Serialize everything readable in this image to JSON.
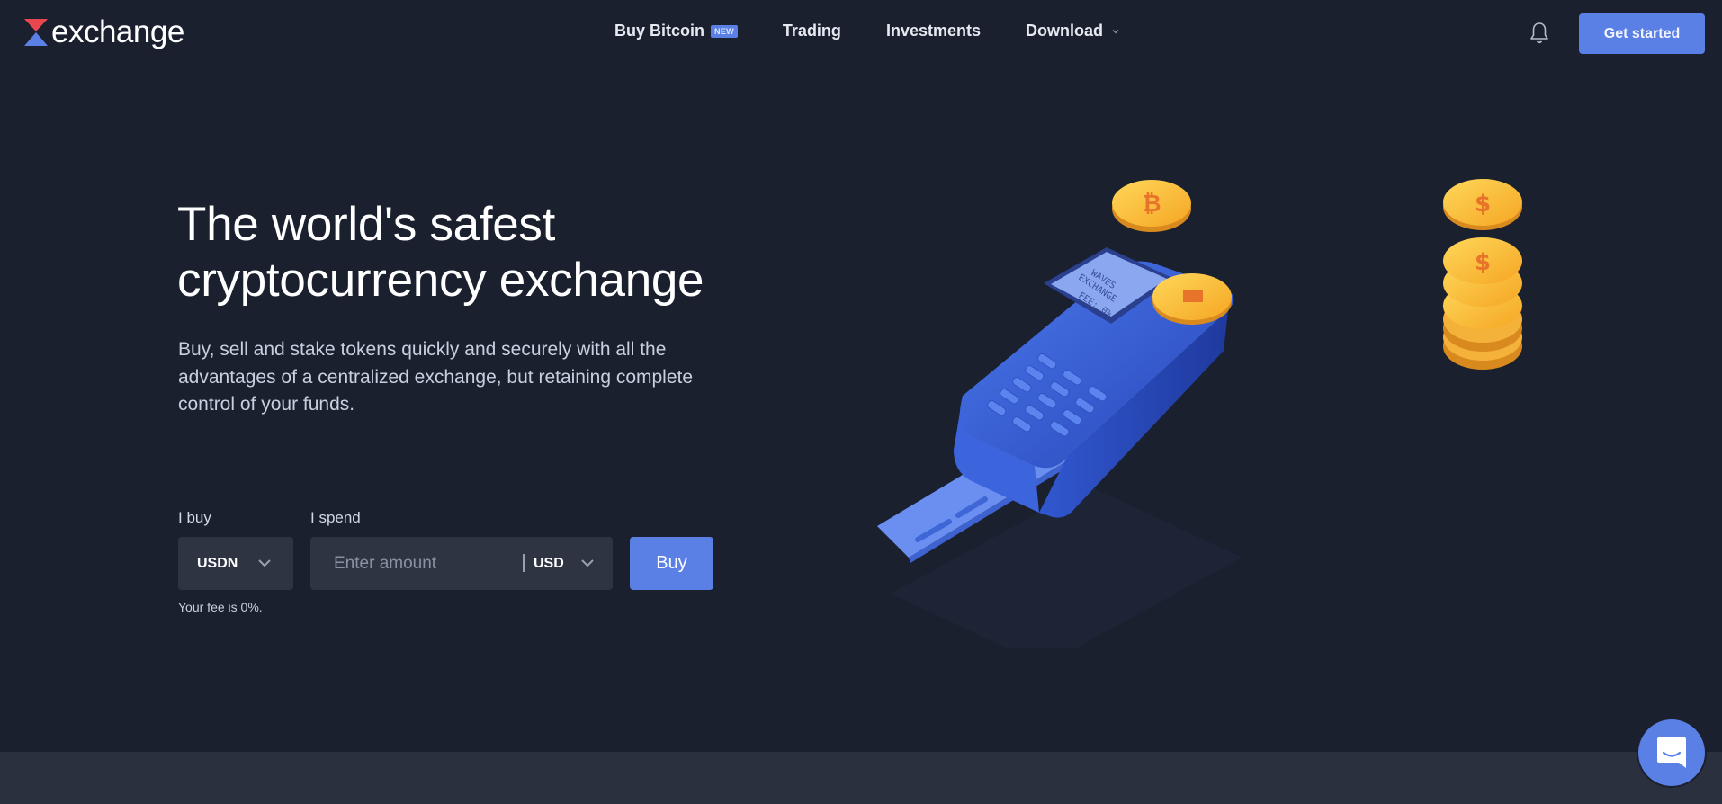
{
  "header": {
    "logo_text": "exchange",
    "nav": [
      {
        "label": "Buy Bitcoin",
        "badge": "NEW"
      },
      {
        "label": "Trading"
      },
      {
        "label": "Investments"
      },
      {
        "label": "Download",
        "icon": "chevron-down-icon"
      }
    ],
    "notification_icon": "bell-icon",
    "get_started_label": "Get started"
  },
  "hero": {
    "title_line1": "The world's safest",
    "title_line2": "cryptocurrency exchange",
    "subtitle": "Buy, sell and stake tokens quickly and securely with all the advantages of a centralized exchange, but retaining complete control of your funds."
  },
  "form": {
    "buy_label": "I buy",
    "buy_asset": "USDN",
    "spend_label": "I spend",
    "amount_value": "",
    "amount_placeholder": "Enter amount",
    "spend_currency": "USD",
    "buy_button": "Buy",
    "fee_text": "Your fee is 0%."
  },
  "illustration": {
    "description": "payment terminal with card and gold coins",
    "screen_line1": "WAVES",
    "screen_line2": "EXCHANGE",
    "screen_line3": "FEE: 0%"
  },
  "colors": {
    "background": "#1a202e",
    "accent": "#5a80e6",
    "input_bg": "#2e3442",
    "footer_band": "#2a303e",
    "logo_red": "#e8474f",
    "logo_blue": "#5a80e6"
  },
  "chat": {
    "icon": "chat-bubble-icon"
  }
}
